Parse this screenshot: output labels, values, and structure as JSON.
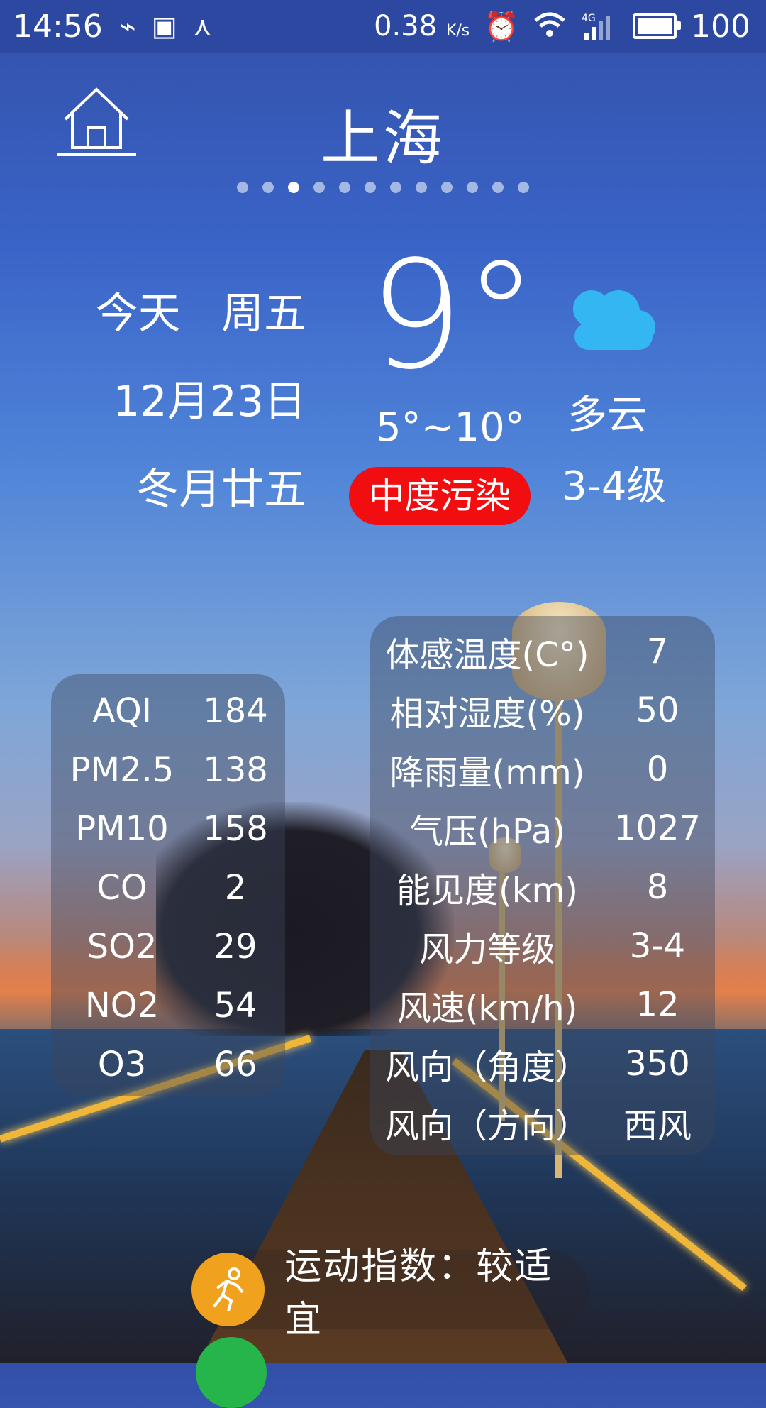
{
  "status_bar": {
    "time": "14:56",
    "net_speed": "0.38",
    "net_speed_unit": "K/s",
    "battery": "100",
    "battery_level": 1.0,
    "icons": [
      "usb-icon",
      "image-icon",
      "share-icon",
      "alarm-icon",
      "wifi-icon",
      "signal-4g-icon",
      "battery-icon"
    ]
  },
  "header": {
    "city": "上海",
    "page_count": 12,
    "active_page": 3
  },
  "today": {
    "day": "今天",
    "weekday": "周五",
    "date": "12月23日",
    "lunar": "冬月廿五"
  },
  "current": {
    "temp": "9°",
    "range": "5°~10°",
    "pollution_badge": "中度污染",
    "weather": "多云",
    "wind_level": "3-4级",
    "weather_icon": "cloud-icon"
  },
  "air_quality": [
    {
      "label": "AQI",
      "value": "184"
    },
    {
      "label": "PM2.5",
      "value": "138"
    },
    {
      "label": "PM10",
      "value": "158"
    },
    {
      "label": "CO",
      "value": "2"
    },
    {
      "label": "SO2",
      "value": "29"
    },
    {
      "label": "NO2",
      "value": "54"
    },
    {
      "label": "O3",
      "value": "66"
    }
  ],
  "details": [
    {
      "label": "体感温度(C°)",
      "value": "7"
    },
    {
      "label": "相对湿度(%)",
      "value": "50"
    },
    {
      "label": "降雨量(mm)",
      "value": "0"
    },
    {
      "label": "气压(hPa)",
      "value": "1027"
    },
    {
      "label": "能见度(km)",
      "value": "8"
    },
    {
      "label": "风力等级",
      "value": "3-4"
    },
    {
      "label": "风速(km/h)",
      "value": "12"
    },
    {
      "label": "风向（角度）",
      "value": "350"
    },
    {
      "label": "风向（方向）",
      "value": "西风"
    }
  ],
  "sport_index": {
    "text": "运动指数：较适宜",
    "icon": "running-person-icon"
  },
  "colors": {
    "pollution": "#f20d10",
    "sport_icon_bg": "#f0a21e",
    "cloud": "#34b6f2"
  }
}
